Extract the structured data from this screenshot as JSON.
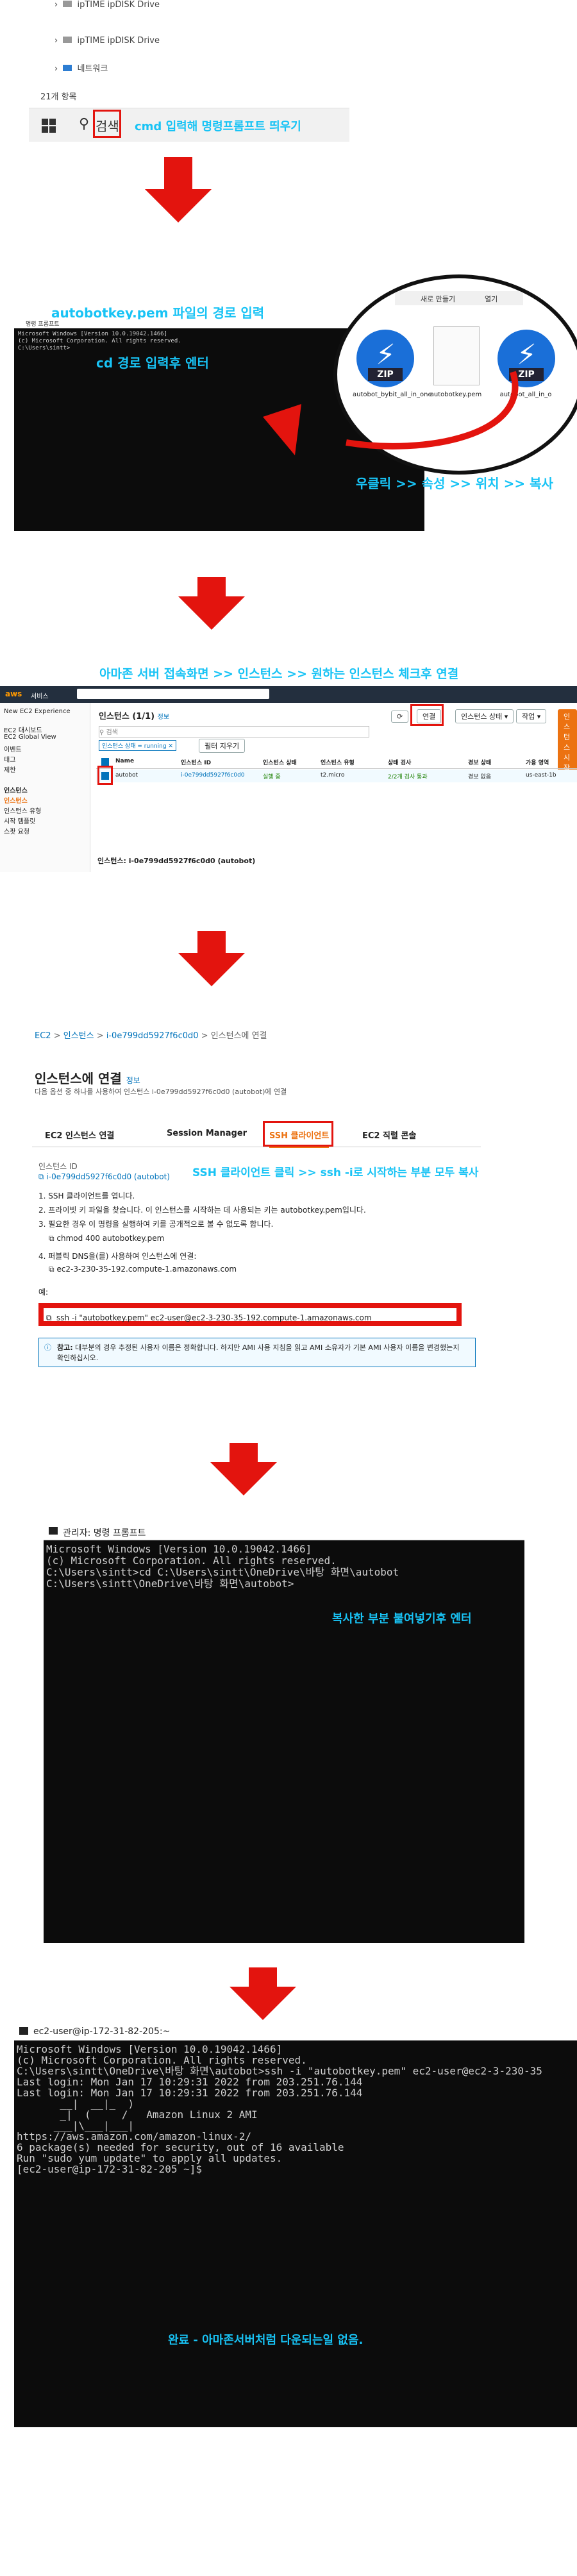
{
  "section1": {
    "tree_items": [
      "ipTIME ipDISK Drive",
      "네트워크"
    ],
    "item_count": "21개 항목",
    "search_text": "검색",
    "caption": "cmd 입력해 명령프롬프트 띄우기"
  },
  "section2": {
    "caption_path": "autobotkey.pem 파일의 경로 입력",
    "caption_cd": "cd 경로 입력후 엔터",
    "cmd_title": "명령 프롬프트",
    "cmd_lines": [
      "Microsoft Windows [Version 10.0.19042.1466]",
      "(c) Microsoft Corporation. All rights reserved.",
      "",
      "C:\\Users\\sintt>"
    ],
    "menu_items": [
      "새로 만들기",
      "열기"
    ],
    "files": [
      "autobot_bybit_all_in_one",
      "autobotkey.pem",
      "autobot_all_in_o"
    ],
    "zip_label": "ZIP",
    "caption_copy": "우클릭 >> 속성 >> 위치 >> 복사"
  },
  "section3": {
    "caption": "아마존 서버 접속화면 >> 인스턴스 >> 원하는 인스턴스 체크후 연결",
    "top_tabs": [
      "서비스",
      "검색"
    ],
    "sidebar": [
      "New EC2 Experience",
      "EC2 대시보드",
      "EC2 Global View",
      "이벤트",
      "태그",
      "제한",
      "인스턴스",
      "인스턴스",
      "인스턴스 유형",
      "시작 템플릿",
      "스팟 요청"
    ],
    "panel_title": "인스턴스 (1/1)",
    "panel_info": "정보",
    "search_placeholder": "검색",
    "filter_chip": "인스턴스 상태 = running",
    "filter_clear": "필터 지우기",
    "buttons": [
      "연결",
      "인스턴스 상태",
      "작업",
      "인스턴스 시작"
    ],
    "columns": [
      "Name",
      "인스턴스 ID",
      "인스턴스 상태",
      "인스턴스 유형",
      "상태 검사",
      "경보 상태",
      "가용 영역"
    ],
    "row": [
      "autobot",
      "i-0e799dd5927f6c0d0",
      "실행 중",
      "t2.micro",
      "2/2개 검사 통과",
      "경보 없음",
      "us-east-1b"
    ],
    "footer": "인스턴스: i-0e799dd5927f6c0d0 (autobot)"
  },
  "section4": {
    "breadcrumb": [
      "EC2",
      "인스턴스",
      "i-0e799dd5927f6c0d0",
      "인스턴스에 연결"
    ],
    "title": "인스턴스에 연결",
    "title_info": "정보",
    "subtitle": "다음 옵션 중 하나를 사용하여 인스턴스 i-0e799dd5927f6c0d0 (autobot)에 연결",
    "tabs": [
      "EC2 인스턴스 연결",
      "Session Manager",
      "SSH 클라이언트",
      "EC2 직렬 콘솔"
    ],
    "caption": "SSH 클라이언트 클릭 >> ssh -i로 시작하는 부분 모두 복사",
    "instance_id_label": "인스턴스 ID",
    "instance_id": "i-0e799dd5927f6c0d0 (autobot)",
    "steps": [
      "1. SSH 클라이언트를 엽니다.",
      "2. 프라이빗 키 파일을 찾습니다. 이 인스턴스를 시작하는 데 사용되는 키는 autobotkey.pem입니다.",
      "3. 필요한 경우 이 명령을 실행하여 키를 공개적으로 볼 수 없도록 합니다.",
      "4. 퍼블릭 DNS을(를) 사용하여 인스턴스에 연결:"
    ],
    "chmod": "chmod 400 autobotkey.pem",
    "dns": "ec2-3-230-35-192.compute-1.amazonaws.com",
    "example_label": "예:",
    "ssh_command": "ssh -i \"autobotkey.pem\" ec2-user@ec2-3-230-35-192.compute-1.amazonaws.com",
    "note_bold": "참고:",
    "note_text": "대부분의 경우 추정된 사용자 이름은 정확합니다. 하지만 AMI 사용 지침을 읽고 AMI 소유자가 기본 AMI 사용자 이름을 변경했는지 확인하십시오."
  },
  "section5": {
    "title": "관리자: 명령 프롬프트",
    "lines": [
      "Microsoft Windows [Version 10.0.19042.1466]",
      "(c) Microsoft Corporation. All rights reserved.",
      "",
      "C:\\Users\\sintt>cd C:\\Users\\sintt\\OneDrive\\바탕 화면\\autobot",
      "",
      "C:\\Users\\sintt\\OneDrive\\바탕 화면\\autobot>"
    ],
    "caption": "복사한 부분 붙여넣기후 엔터"
  },
  "section6": {
    "title": "ec2-user@ip-172-31-82-205:~",
    "lines": [
      "Microsoft Windows [Version 10.0.19042.1466]",
      "(c) Microsoft Corporation. All rights reserved.",
      "",
      "C:\\Users\\sintt\\OneDrive\\바탕 화면\\autobot>ssh -i \"autobotkey.pem\" ec2-user@ec2-3-230-35",
      "Last login: Mon Jan 17 10:29:31 2022 from 203.251.76.144",
      "Last login: Mon Jan 17 10:29:31 2022 from 203.251.76.144",
      "",
      "       __|  __|_  )",
      "       _|  (     /   Amazon Linux 2 AMI",
      "      ___|\\___|___|",
      "",
      "https://aws.amazon.com/amazon-linux-2/",
      "6 package(s) needed for security, out of 16 available",
      "Run \"sudo yum update\" to apply all updates.",
      "[ec2-user@ip-172-31-82-205 ~]$"
    ],
    "caption": "완료 - 아마존서버처럼 다운되는일 없음."
  },
  "colors": {
    "accent_red": "#e3140e",
    "caption_cyan": "#18c3f5",
    "aws_orange": "#ec7211",
    "aws_link": "#0073bb"
  }
}
